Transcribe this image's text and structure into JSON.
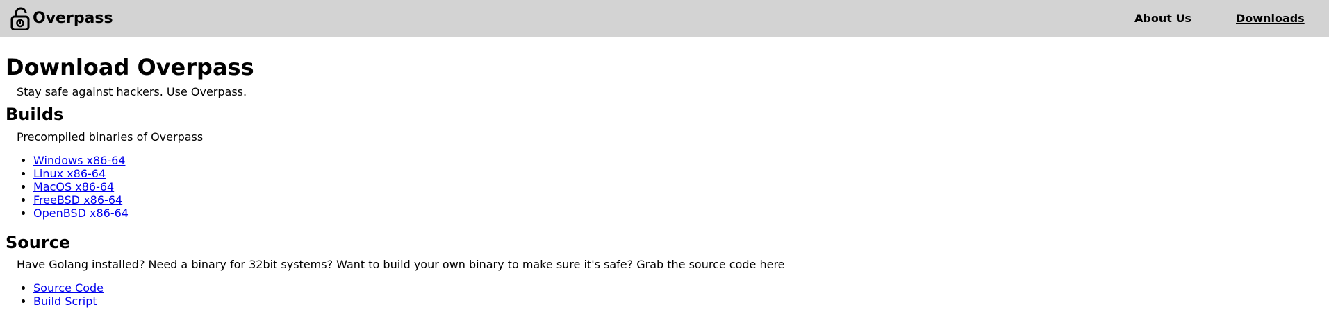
{
  "header": {
    "brand": "Overpass",
    "nav": [
      {
        "label": "About Us"
      },
      {
        "label": "Downloads"
      }
    ]
  },
  "main": {
    "title": "Download Overpass",
    "tagline": "Stay safe against hackers. Use Overpass.",
    "builds": {
      "heading": "Builds",
      "description": "Precompiled binaries of Overpass",
      "links": [
        {
          "label": "Windows x86-64"
        },
        {
          "label": "Linux x86-64"
        },
        {
          "label": "MacOS x86-64"
        },
        {
          "label": "FreeBSD x86-64"
        },
        {
          "label": "OpenBSD x86-64"
        }
      ]
    },
    "source": {
      "heading": "Source",
      "description": "Have Golang installed? Need a binary for 32bit systems? Want to build your own binary to make sure it's safe? Grab the source code here",
      "links": [
        {
          "label": "Source Code"
        },
        {
          "label": "Build Script"
        }
      ]
    }
  },
  "colors": {
    "navbar_bg": "#d3d3d3",
    "link": "#0000ee",
    "text": "#000000"
  }
}
